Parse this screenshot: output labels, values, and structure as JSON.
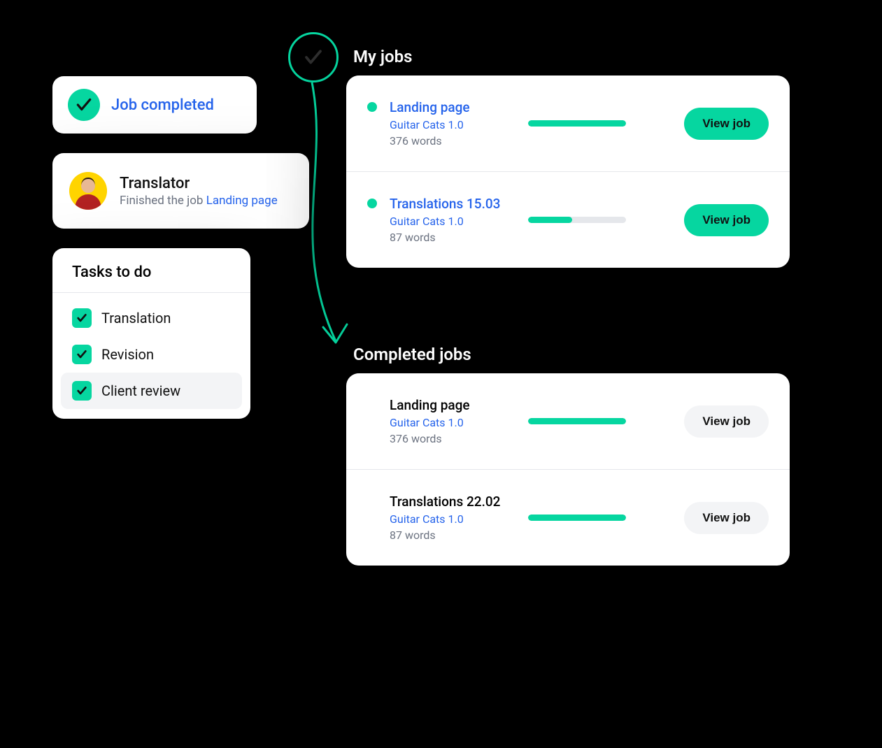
{
  "accent": "#06D6A0",
  "link": "#2563EB",
  "job_completed": {
    "label": "Job completed"
  },
  "translator": {
    "title": "Translator",
    "prefix": "Finished the job ",
    "job_link": "Landing page"
  },
  "tasks": {
    "heading": "Tasks to do",
    "items": [
      {
        "label": "Translation",
        "checked": true,
        "highlight": false
      },
      {
        "label": "Revision",
        "checked": true,
        "highlight": false
      },
      {
        "label": "Client review",
        "checked": true,
        "highlight": true
      }
    ]
  },
  "sections": {
    "my_jobs": {
      "heading": "My jobs",
      "button_label": "View job",
      "jobs": [
        {
          "title": "Landing page",
          "project": "Guitar Cats 1.0",
          "words": "376 words",
          "progress_pct": 100,
          "title_link": true,
          "button_style": "primary"
        },
        {
          "title": "Translations 15.03",
          "project": "Guitar Cats 1.0",
          "words": "87 words",
          "progress_pct": 45,
          "title_link": true,
          "button_style": "primary"
        }
      ]
    },
    "completed": {
      "heading": "Completed jobs",
      "button_label": "View job",
      "jobs": [
        {
          "title": "Landing page",
          "project": "Guitar Cats 1.0",
          "words": "376 words",
          "progress_pct": 100,
          "title_link": false,
          "button_style": "secondary"
        },
        {
          "title": "Translations 22.02",
          "project": "Guitar Cats 1.0",
          "words": "87 words",
          "progress_pct": 100,
          "title_link": false,
          "button_style": "secondary"
        }
      ]
    }
  }
}
